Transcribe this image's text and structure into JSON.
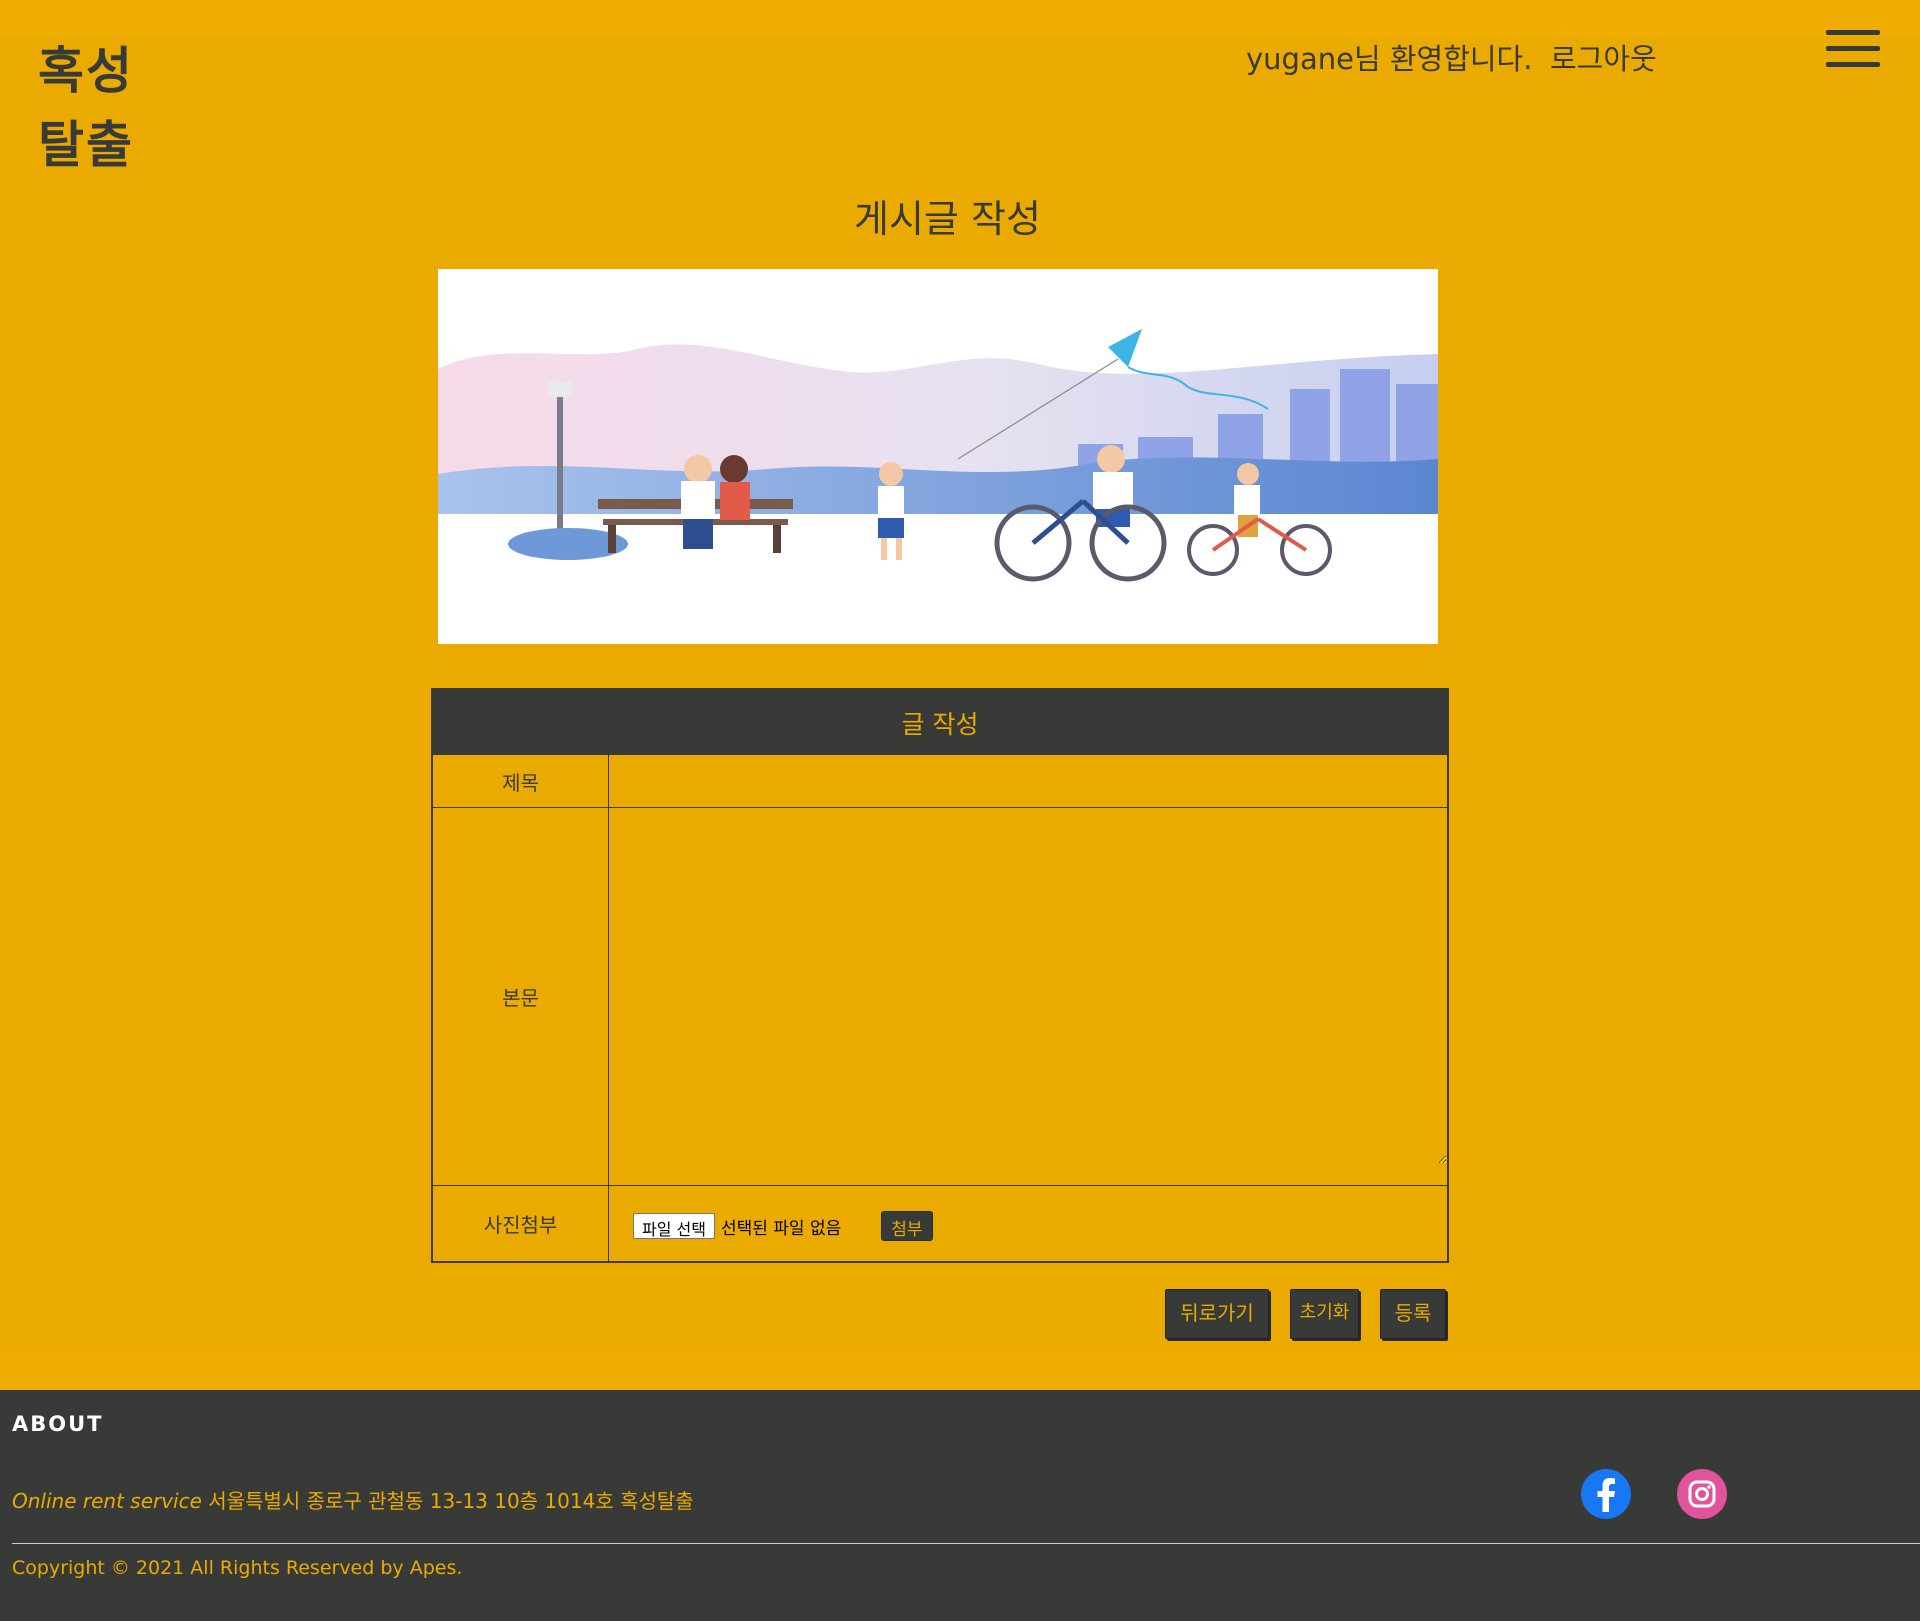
{
  "header": {
    "logo_line1": "혹성",
    "logo_line2": "탈출",
    "welcome": "yugane님 환영합니다.",
    "logout": "로그아웃",
    "menu_icon": "hamburger-icon"
  },
  "page": {
    "title": "게시글 작성"
  },
  "banner": {
    "image": "park-illustration"
  },
  "form": {
    "header": "글 작성",
    "title_label": "제목",
    "title_value": "",
    "body_label": "본문",
    "body_value": "",
    "photo_label": "사진첨부",
    "file_button": "파일 선택",
    "file_status": "선택된 파일 없음",
    "attach_button": "첨부"
  },
  "actions": {
    "back": "뒤로가기",
    "reset": "초기화",
    "submit": "등록"
  },
  "footer": {
    "about": "ABOUT",
    "address_italic": "Online rent service",
    "address": " 서울특별시 종로구 관철동 13-13 10층 1014호 혹성탈출",
    "copyright": "Copyright © 2021 All Rights Reserved by Apes.",
    "social": [
      "facebook-icon",
      "instagram-icon"
    ]
  },
  "colors": {
    "background": "#EAAA00",
    "dark": "#373A36",
    "facebook": "#1877F2",
    "instagram": "#E1549B"
  }
}
